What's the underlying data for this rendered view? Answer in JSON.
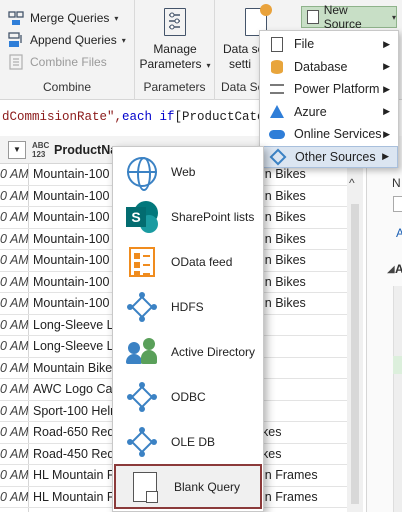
{
  "ribbon": {
    "combine": {
      "merge_queries": "Merge Queries",
      "append_queries": "Append Queries",
      "combine_files": "Combine Files",
      "group_label": "Combine"
    },
    "parameters": {
      "manage_line1": "Manage",
      "manage_line2": "Parameters",
      "group_label": "Parameters"
    },
    "data_source": {
      "line1": "Data so",
      "line2": "setti",
      "group_label": "Data So"
    },
    "new_source_label": "New Source",
    "caret": "▾"
  },
  "formula_bar": {
    "part1": "dCommisionRate\", ",
    "keyword": "each if",
    "part2": " [ProductCateg"
  },
  "grid": {
    "column_type_top": "ABC",
    "column_type_bottom": "123",
    "column_name": "ProductNam",
    "rows": [
      {
        "time": "0 AM",
        "product": "Mountain-100 Bl",
        "category": "in Bikes"
      },
      {
        "time": "0 AM",
        "product": "Mountain-100 Bl",
        "category": "in Bikes"
      },
      {
        "time": "0 AM",
        "product": "Mountain-100 Bl",
        "category": "in Bikes"
      },
      {
        "time": "0 AM",
        "product": "Mountain-100 Si",
        "category": "in Bikes"
      },
      {
        "time": "0 AM",
        "product": "Mountain-100 Si",
        "category": "in Bikes"
      },
      {
        "time": "0 AM",
        "product": "Mountain-100 Si",
        "category": "in Bikes"
      },
      {
        "time": "0 AM",
        "product": "Mountain-100 Si",
        "category": "in Bikes"
      },
      {
        "time": "0 AM",
        "product": "Long-Sleeve Logo",
        "category": ""
      },
      {
        "time": "0 AM",
        "product": "Long-Sleeve Logo",
        "category": ""
      },
      {
        "time": "0 AM",
        "product": "Mountain Bike Sc",
        "category": ""
      },
      {
        "time": "0 AM",
        "product": "AWC Logo Cap",
        "category": ""
      },
      {
        "time": "0 AM",
        "product": "Sport-100 Helme",
        "category": ""
      },
      {
        "time": "0 AM",
        "product": "Road-650 Red, 4",
        "category": "kes"
      },
      {
        "time": "0 AM",
        "product": "Road-450 Red, 5",
        "category": "kes"
      },
      {
        "time": "0 AM",
        "product": "HL Mountain Fra",
        "category": "in Frames"
      },
      {
        "time": "0 AM",
        "product": "HL Mountain Fra",
        "category": "in Frames"
      }
    ]
  },
  "right_pane": {
    "n_label": "N",
    "a_label": "A",
    "section_label": "A",
    "tri": "◢"
  },
  "new_source_menu": [
    {
      "label": "File",
      "icon": "file-icon",
      "has_submenu": true
    },
    {
      "label": "Database",
      "icon": "database-icon",
      "has_submenu": true
    },
    {
      "label": "Power Platform",
      "icon": "power-platform-icon",
      "has_submenu": true
    },
    {
      "label": "Azure",
      "icon": "azure-icon",
      "has_submenu": true
    },
    {
      "label": "Online Services",
      "icon": "cloud-icon",
      "has_submenu": true
    },
    {
      "label": "Other Sources",
      "icon": "other-sources-icon",
      "has_submenu": true,
      "active": true
    }
  ],
  "other_sources_menu": [
    {
      "label": "Web",
      "icon": "globe-icon"
    },
    {
      "label": "SharePoint lists",
      "icon": "sharepoint-icon"
    },
    {
      "label": "OData feed",
      "icon": "odata-icon"
    },
    {
      "label": "HDFS",
      "icon": "hdfs-icon"
    },
    {
      "label": "Active Directory",
      "icon": "active-directory-icon"
    },
    {
      "label": "ODBC",
      "icon": "odbc-icon"
    },
    {
      "label": "OLE DB",
      "icon": "oledb-icon"
    },
    {
      "label": "Blank Query",
      "icon": "blank-query-icon",
      "highlighted": true
    }
  ],
  "colors": {
    "accent_blue": "#3b82c4",
    "new_source_bg": "#c8dfc6",
    "highlight_border": "#8b3a3a",
    "active_item_bg": "#dbe5f1"
  }
}
